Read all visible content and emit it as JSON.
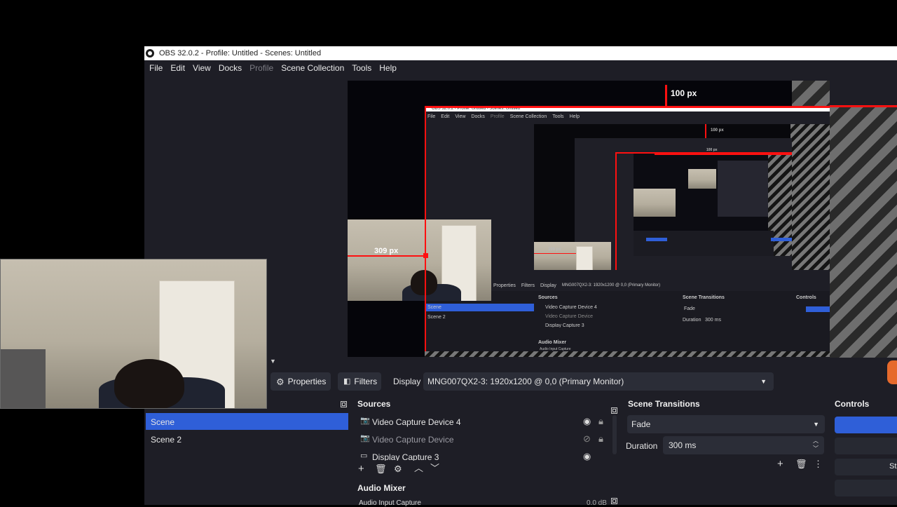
{
  "window": {
    "title": "OBS 32.0.2 - Profile: Untitled - Scenes: Untitled"
  },
  "menu": {
    "items": [
      "File",
      "Edit",
      "View",
      "Docks",
      "Profile",
      "Scene Collection",
      "Tools",
      "Help"
    ],
    "disabled": [
      "Profile"
    ]
  },
  "preview": {
    "label_top": "100 px",
    "label_left": "309 px"
  },
  "nested": {
    "title": "OBS 32.0.2 - Profile: Untitled - Scenes: Untitled",
    "menu": [
      "File",
      "Edit",
      "View",
      "Docks",
      "Profile",
      "Scene Collection",
      "Tools",
      "Help"
    ],
    "label_top": "100 px",
    "label_left": "309 px",
    "properties": "Properties",
    "filters": "Filters",
    "display": "Display",
    "monitor": "MNG007QX2-3: 1920x1200 @ 0,0 (Primary Monitor)",
    "sources_header": "Sources",
    "scene_transitions_header": "Scene Transitions",
    "controls_header": "Controls",
    "scene_selected": "Scene",
    "scene_2": "Scene 2",
    "source_1": "Video Capture Device 4",
    "source_2": "Video Capture Device",
    "source_3": "Display Capture 3",
    "fade": "Fade",
    "duration_label": "Duration",
    "duration_value": "300 ms",
    "audio_mixer": "Audio Mixer",
    "audio_input": "Audio Input Capture"
  },
  "toolbar": {
    "properties_label": "Properties",
    "filters_label": "Filters",
    "display_label": "Display",
    "monitor_value": "MNG007QX2-3: 1920x1200 @ 0,0 (Primary Monitor)"
  },
  "scenes": {
    "items": [
      "Scene",
      "Scene 2"
    ],
    "selected": 0
  },
  "sources": {
    "header": "Sources",
    "items": [
      {
        "label": "Video Capture Device 4",
        "visible": true
      },
      {
        "label": "Video Capture Device",
        "visible": false
      },
      {
        "label": "Display Capture 3",
        "visible": true
      }
    ]
  },
  "transitions": {
    "header": "Scene Transitions",
    "type": "Fade",
    "duration_label": "Duration",
    "duration_value": "300 ms"
  },
  "controls": {
    "header": "Controls",
    "partial_text": "St"
  },
  "audio_mixer": {
    "header": "Audio Mixer",
    "source": "Audio Input Capture",
    "level": "0.0 dB"
  },
  "colors": {
    "accent": "#2f5fd8",
    "panel_bg": "#1e1e26",
    "guide_red": "#ff1010"
  },
  "icons": {
    "eye": "eye-icon",
    "eye_hidden": "eye-slash-icon",
    "lock": "lock-icon",
    "camera": "camera-icon",
    "monitor": "monitor-icon"
  }
}
